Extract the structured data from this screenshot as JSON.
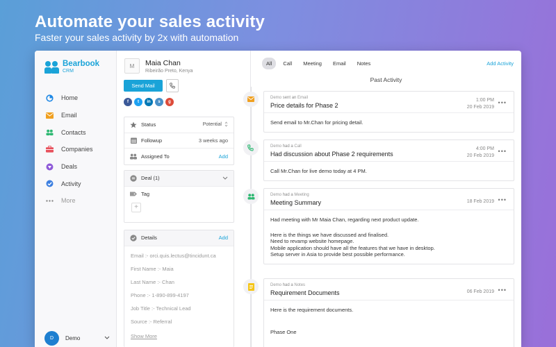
{
  "hero": {
    "title": "Automate your sales activity",
    "subtitle": "Faster your sales activity by 2x with automation"
  },
  "brand": {
    "name": "Bearbook",
    "sub": "CRM",
    "color": "#1aa3d8"
  },
  "nav": [
    {
      "label": "Home",
      "icon": "home-icon"
    },
    {
      "label": "Email",
      "icon": "email-icon"
    },
    {
      "label": "Contacts",
      "icon": "contacts-icon"
    },
    {
      "label": "Companies",
      "icon": "companies-icon"
    },
    {
      "label": "Deals",
      "icon": "deals-icon"
    },
    {
      "label": "Activity",
      "icon": "activity-icon"
    },
    {
      "label": "More",
      "icon": "more-icon"
    }
  ],
  "user": {
    "initial": "D",
    "name": "Demo"
  },
  "contact": {
    "initial": "M",
    "name": "Maia Chan",
    "location": "Ribeirão Preto, Kenya",
    "send_mail": "Send Mail",
    "status": {
      "label": "Status",
      "value": "Potential"
    },
    "followup": {
      "label": "Followup",
      "value": "3 weeks ago"
    },
    "assigned": {
      "label": "Assigned To",
      "action": "Add"
    },
    "deal": {
      "label": "Deal (1)"
    },
    "tag": {
      "label": "Tag"
    },
    "details": {
      "label": "Details",
      "action": "Add",
      "items": [
        "Email :- orci.quis.lectus@tincidunt.ca",
        "First Name :- Maia",
        "Last Name :- Chan",
        "Phone :- 1-890-899-4197",
        "Job Title :- Technical Lead",
        "Source :- Referral"
      ],
      "show_more": "Show More"
    }
  },
  "activity": {
    "tabs": [
      "All",
      "Call",
      "Meeting",
      "Email",
      "Notes"
    ],
    "add_label": "Add Activity",
    "heading": "Past Activity",
    "items": [
      {
        "by": "Demo",
        "verb": "sent an",
        "type": "Email",
        "title": "Price details for Phase 2",
        "time": "1:00 PM",
        "date": "20 Feb 2019",
        "body": [
          "Send email to Mr.Chan for pricing detail."
        ]
      },
      {
        "by": "Demo",
        "verb": "had a",
        "type": "Call",
        "title": "Had discussion about Phase 2 requirements",
        "time": "4:00 PM",
        "date": "20 Feb 2019",
        "body": [
          "Call Mr.Chan for live demo today at 4 PM."
        ]
      },
      {
        "by": "Demo",
        "verb": "had a",
        "type": "Meeting",
        "title": "Meeting Summary",
        "date": "18 Feb 2019",
        "body": [
          "Had meeting with Mr Maia Chan, regarding next product update.",
          "",
          "Here is the things we have discussed and finalised.",
          "Need to revamp website homepage.",
          "Mobile application should have all the features that we have in desktop.",
          "Setup server in Asia to provide best possible performance."
        ]
      },
      {
        "by": "Demo",
        "verb": "had a",
        "type": "Notes",
        "title": "Requirement Documents",
        "date": "06 Feb 2019",
        "body": [
          "Here is the requirement documents.",
          "",
          "Phase One"
        ]
      }
    ]
  }
}
